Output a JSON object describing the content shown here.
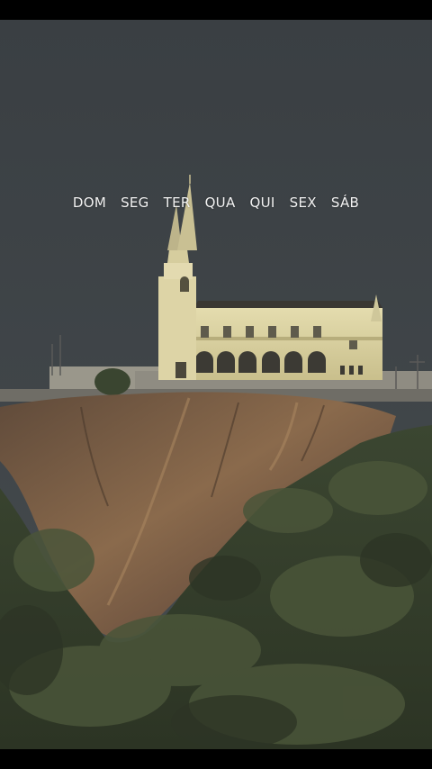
{
  "weekdays": [
    "DOM",
    "SEG",
    "TER",
    "QUA",
    "QUI",
    "SEX",
    "SÁB"
  ],
  "colors": {
    "sky": "#3d4246",
    "letterbox": "#000000",
    "church": "#d8cf9f",
    "rock": "#7a5a40",
    "vegetation": "#3e4a2f"
  },
  "scene": {
    "subject": "church-on-rocky-hill-icon"
  }
}
